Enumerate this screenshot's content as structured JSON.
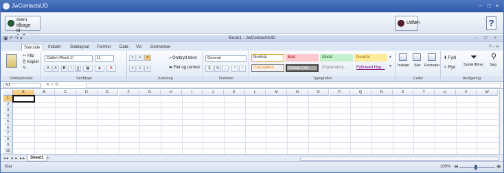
{
  "window": {
    "title": "JwContactsUD",
    "controls": [
      "–",
      "□",
      "×"
    ]
  },
  "toolbar": {
    "back_button": [
      "Gem tilbage",
      "til JwContacts"
    ],
    "logout_button": "Udføn",
    "help_button": "?"
  },
  "excel": {
    "title": "Book1 - JwContactsUD",
    "quick_access": "▣ ↶ ↷ ▾",
    "window_buttons": "– □ ×",
    "tabs": [
      "Startside",
      "Indsæt",
      "Sidelayout",
      "Formler",
      "Data",
      "Vis",
      "Gennemse"
    ],
    "active_tab": "Startside",
    "right_tools": "? – ✕"
  },
  "ribbon": {
    "clipboard": {
      "paste": "Sæt ind",
      "cut": "Klip",
      "copy": "Kopiér",
      "label": "Udklipsholder"
    },
    "font": {
      "name": "Calibri (Afsnit 1)",
      "size": "11",
      "grow": "A",
      "shrink": "A",
      "bold": "B",
      "italic": "I",
      "underline": "U",
      "label": "Skrifttype"
    },
    "alignment": {
      "wrap": "Ombryd tekst",
      "merge": "Flet og centrer",
      "label": "Justering"
    },
    "number": {
      "format": "General",
      "currency": "$",
      "percent": "%",
      "comma": ",",
      "label": "Nummer"
    },
    "styles": {
      "normal": "Normal",
      "bad": "Bad",
      "good": "Good",
      "neutral": "Neutral",
      "calculation": "Calculation",
      "check_cell": "Check Cell",
      "explanatory": "Explanatory ...",
      "followed_hyp": "Followed Hyp...",
      "label": "Typografier",
      "colors": {
        "bad_bg": "#ffc7ce",
        "bad_fg": "#9c0006",
        "good_bg": "#c6efce",
        "good_fg": "#006100",
        "neutral_bg": "#ffeb9c",
        "neutral_fg": "#9c6500",
        "calc_fg": "#fa7d00",
        "check_bg": "#a5a5a5",
        "hyp_fg": "#800080"
      }
    },
    "cells": {
      "insert": "Indsæt",
      "delete": "Slet",
      "format": "Formater",
      "label": "Celler"
    },
    "editing": {
      "autosum": "Fyld",
      "fill": "Ryd",
      "sort": "Sortér/filtrer",
      "find": "Søg",
      "label": "Redigering"
    }
  },
  "formula_bar": {
    "cell_ref": "A1",
    "fx": "fx",
    "value": ""
  },
  "grid": {
    "columns": [
      "A",
      "B",
      "C",
      "D",
      "E",
      "F",
      "G",
      "H",
      "I",
      "J",
      "K",
      "L",
      "M",
      "N",
      "O",
      "P",
      "Q",
      "R",
      "S",
      "T",
      "U",
      "V",
      "W"
    ],
    "rows": [
      "1",
      "2",
      "3",
      "4",
      "5",
      "6",
      "7",
      "8",
      "9",
      "10"
    ],
    "active_cell": "A1"
  },
  "sheets": {
    "nav": "◂◂ ◂ ▸ ▸▸",
    "active": "Sheet1"
  },
  "status": {
    "text": "Klar",
    "zoom": "100%"
  }
}
